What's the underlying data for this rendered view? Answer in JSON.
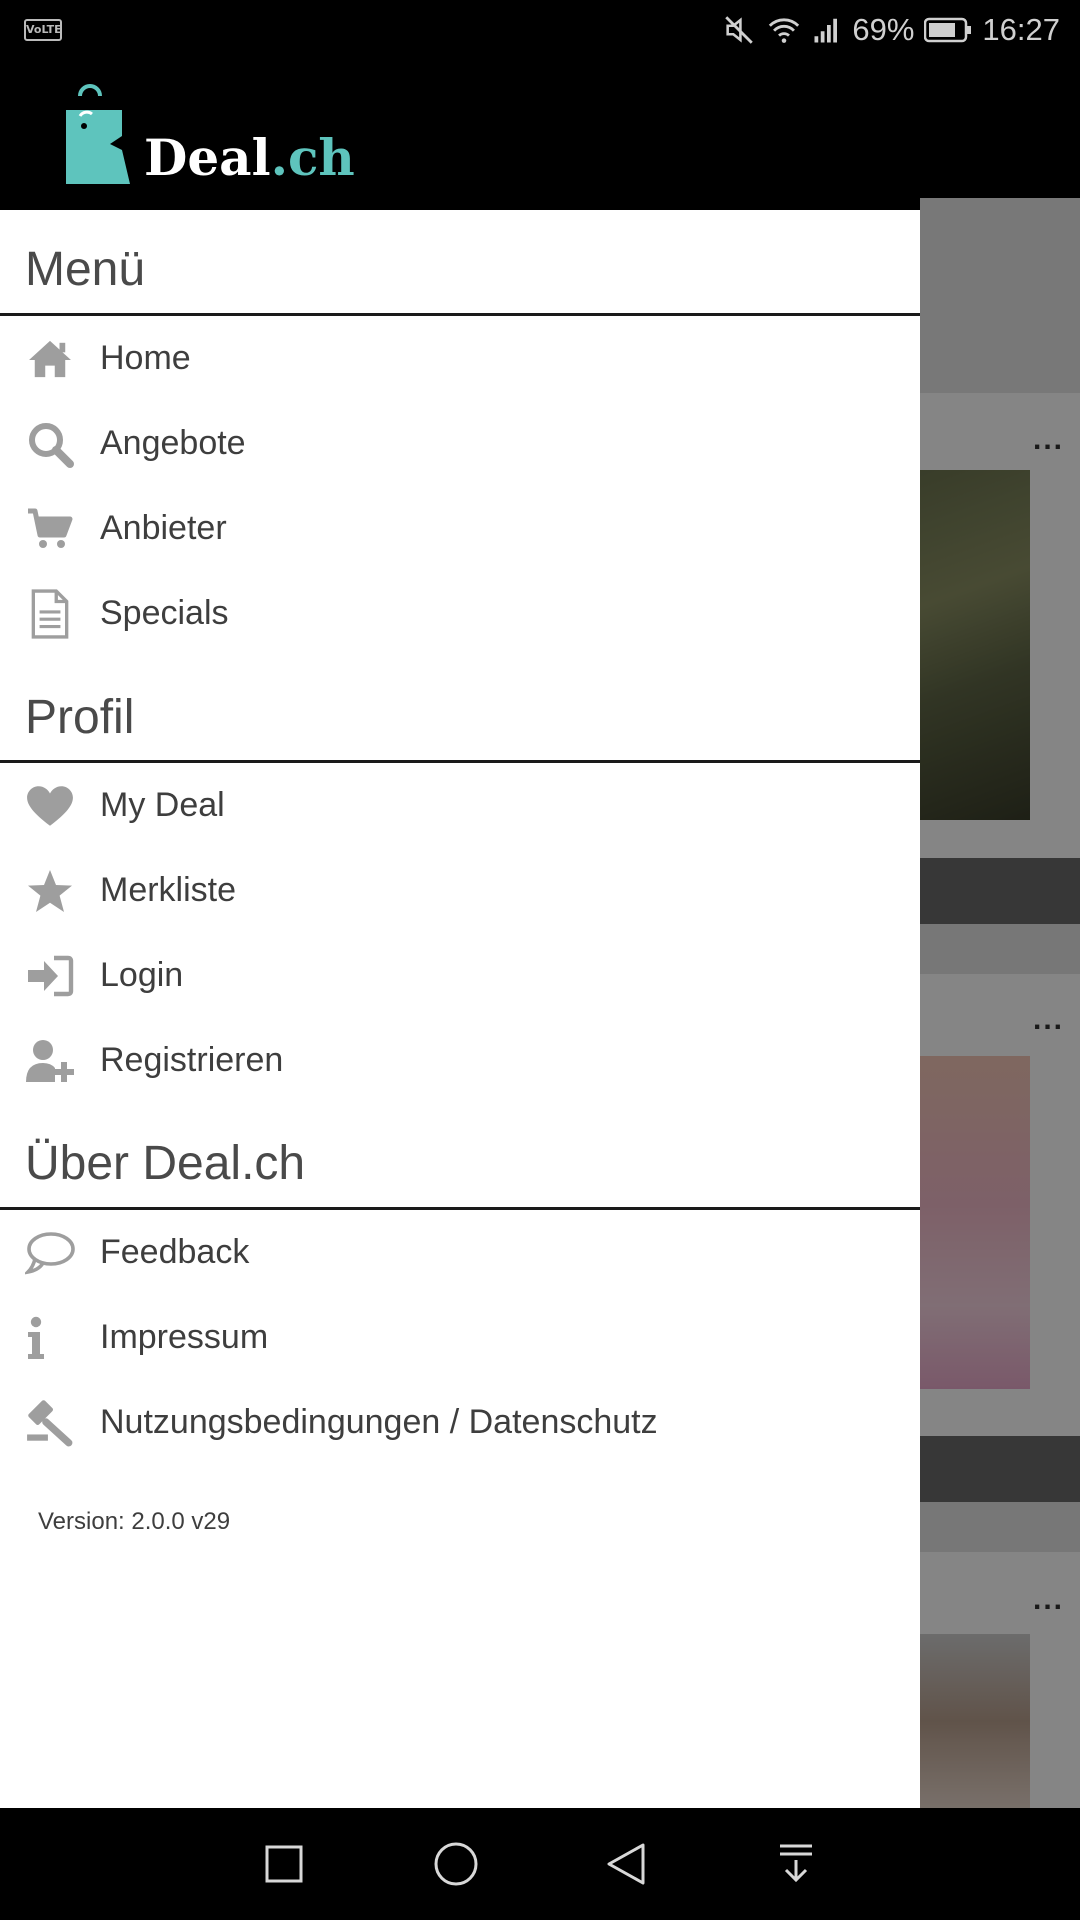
{
  "status_bar": {
    "volte": "VoLTE",
    "battery": "69%",
    "time": "16:27"
  },
  "app": {
    "logo_text_main": "Deal",
    "logo_text_suffix": ".ch",
    "brand_color": "#5ec4bd"
  },
  "drawer": {
    "sections": [
      {
        "title": "Menü",
        "items": [
          {
            "label": "Home",
            "icon": "home-icon"
          },
          {
            "label": "Angebote",
            "icon": "search-icon"
          },
          {
            "label": "Anbieter",
            "icon": "cart-icon"
          },
          {
            "label": "Specials",
            "icon": "document-icon"
          }
        ]
      },
      {
        "title": "Profil",
        "items": [
          {
            "label": "My Deal",
            "icon": "heart-icon"
          },
          {
            "label": "Merkliste",
            "icon": "star-icon"
          },
          {
            "label": "Login",
            "icon": "login-icon"
          },
          {
            "label": "Registrieren",
            "icon": "add-user-icon"
          }
        ]
      },
      {
        "title": "Über Deal.ch",
        "items": [
          {
            "label": "Feedback",
            "icon": "speech-bubble-icon"
          },
          {
            "label": "Impressum",
            "icon": "info-icon"
          },
          {
            "label": "Nutzungsbedingungen / Datenschutz",
            "icon": "gavel-icon"
          }
        ]
      }
    ],
    "version": "Version: 2.0.0 v29"
  },
  "background": {
    "more_label": "..."
  },
  "colors": {
    "icon_gray": "#9e9e9e",
    "text": "#3e3e3e",
    "rule": "#1a1a1a"
  }
}
